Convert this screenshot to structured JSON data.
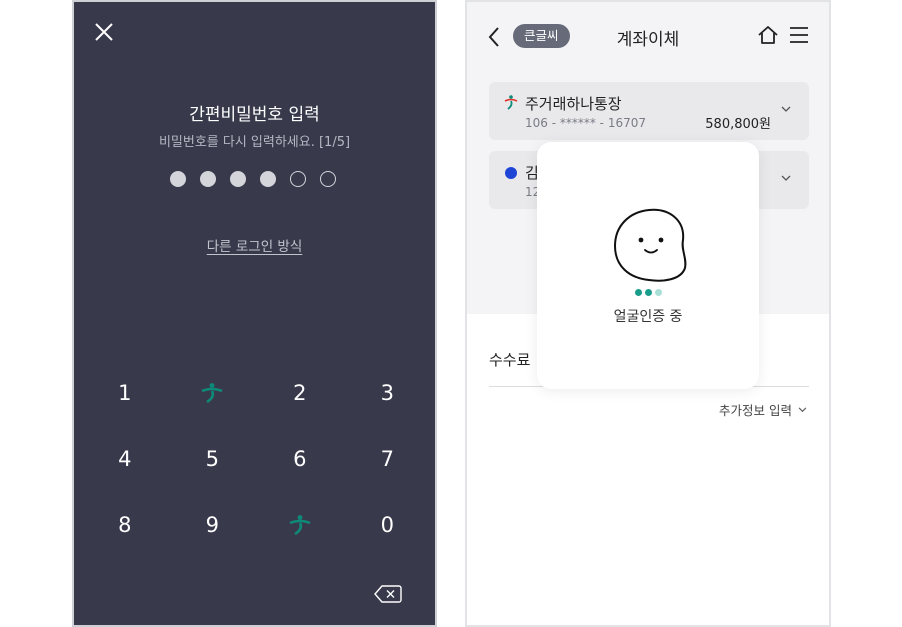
{
  "pin_screen": {
    "title": "간편비밀번호 입력",
    "subtitle": "비밀번호를 다시 입력하세요. [1/5]",
    "pin_dots": {
      "filled": 4,
      "total": 6
    },
    "alt_login": "다른 로그인 방식",
    "keypad": [
      "1",
      "hana-logo",
      "2",
      "3",
      "4",
      "5",
      "6",
      "7",
      "8",
      "9",
      "hana-logo",
      "0"
    ],
    "colors": {
      "background": "#383a4c",
      "logo_green": "#0e8a78"
    }
  },
  "transfer_screen": {
    "badge": "큰글씨",
    "title": "계좌이체",
    "accounts": [
      {
        "name": "주거래하나통장",
        "number": "106 - ****** - 16707",
        "balance": "580,800원"
      },
      {
        "name": "김",
        "number": "12"
      }
    ],
    "fee_label": "수수료 !",
    "extra_info": "추가정보 입력",
    "colors": {
      "account_dot": "#1f45d6"
    }
  },
  "face_auth": {
    "status": "얼굴인증 중",
    "loading_colors": [
      "#1a9e8c",
      "#1a9e8c",
      "#a9dfd7"
    ]
  }
}
